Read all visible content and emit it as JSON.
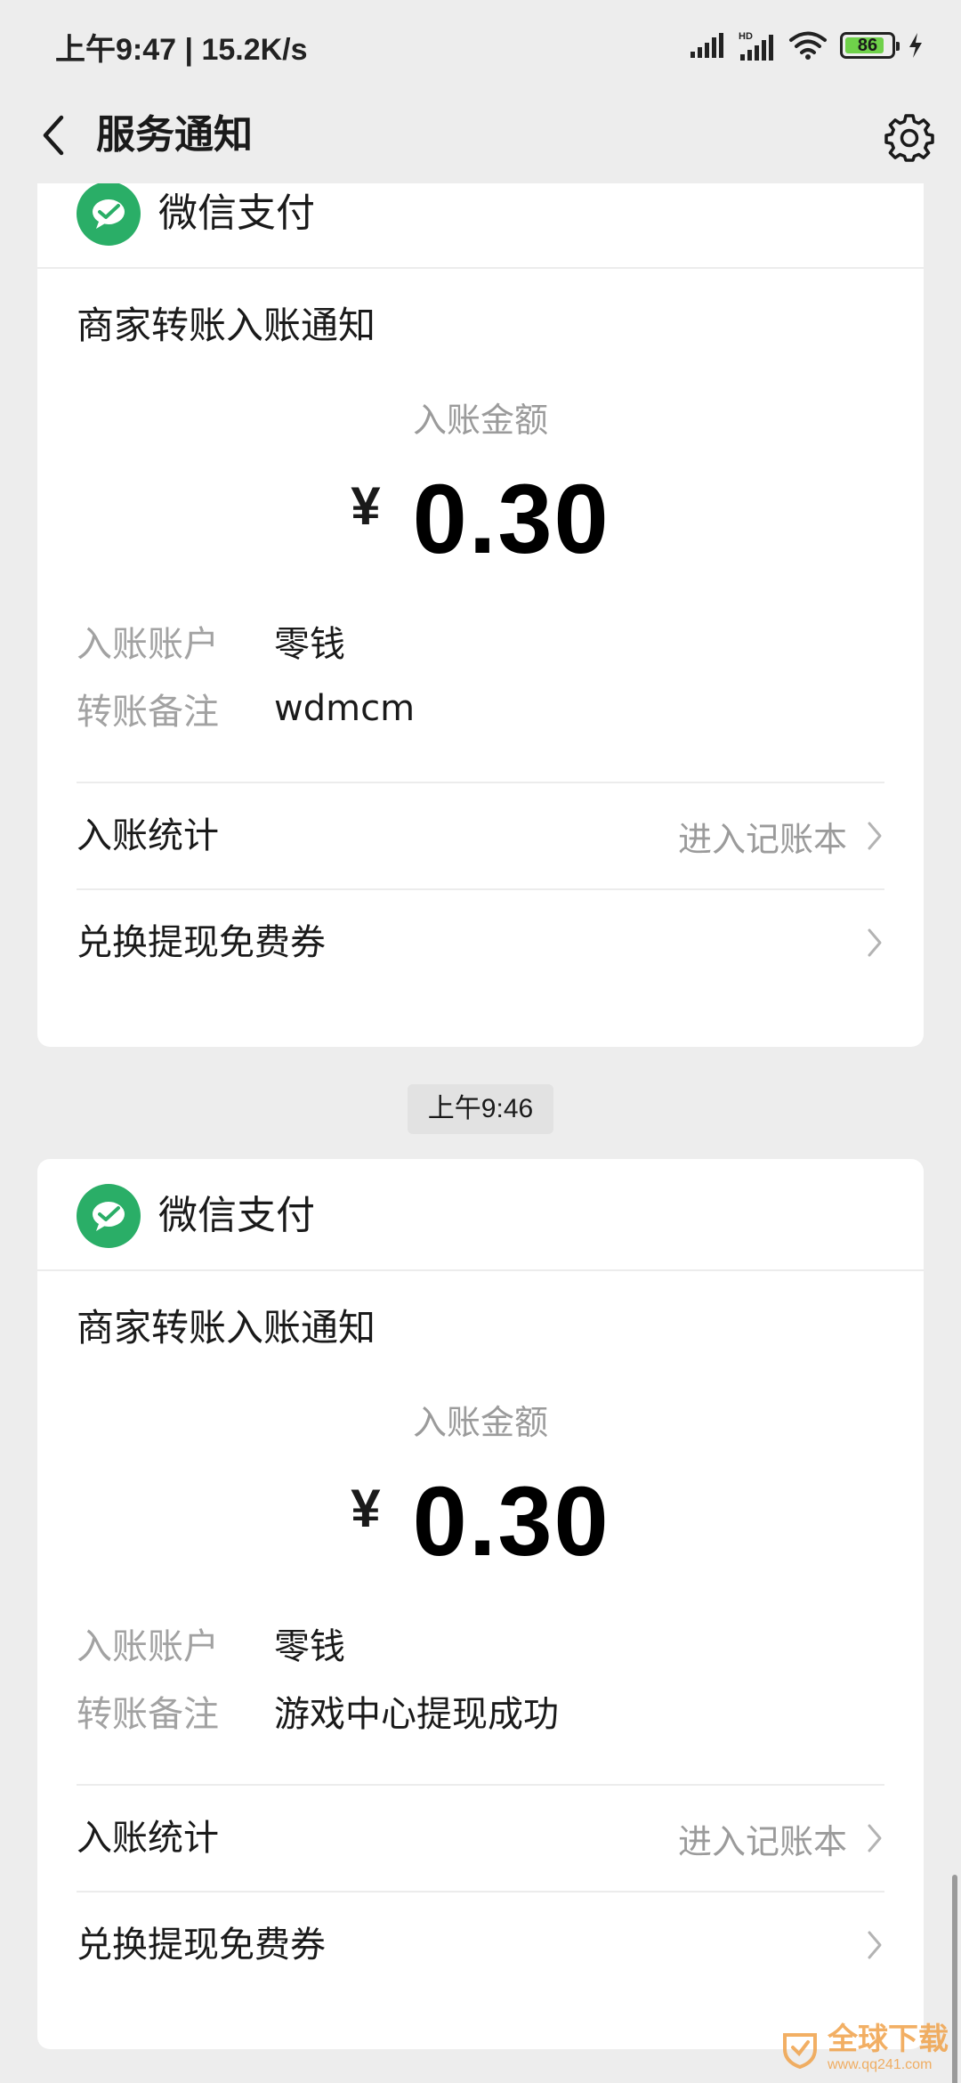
{
  "status_bar": {
    "time_speed": "上午9:47 | 15.2K/s",
    "battery_level": "86",
    "battery_percent": 86,
    "icons": [
      "signal-icon",
      "hd-signal-icon",
      "wifi-icon",
      "battery-icon",
      "charging-icon"
    ]
  },
  "nav": {
    "title": "服务通知",
    "back_icon": "chevron-left-icon",
    "settings_icon": "gear-icon"
  },
  "colors": {
    "wechat_green": "#2aae67",
    "background": "#ededed",
    "card": "#ffffff",
    "muted_text": "#9b9b9b"
  },
  "timestamp_between": "上午9:46",
  "cards": [
    {
      "pay_name": "微信支付",
      "title": "商家转账入账通知",
      "amount_label": "入账金额",
      "currency": "¥",
      "amount": "0.30",
      "details": [
        {
          "label": "入账账户",
          "value": "零钱"
        },
        {
          "label": "转账备注",
          "value": "wdmcm"
        }
      ],
      "links": [
        {
          "label": "入账统计",
          "hint": "进入记账本"
        },
        {
          "label": "兑换提现免费券",
          "hint": ""
        }
      ]
    },
    {
      "pay_name": "微信支付",
      "title": "商家转账入账通知",
      "amount_label": "入账金额",
      "currency": "¥",
      "amount": "0.30",
      "details": [
        {
          "label": "入账账户",
          "value": "零钱"
        },
        {
          "label": "转账备注",
          "value": "游戏中心提现成功"
        }
      ],
      "links": [
        {
          "label": "入账统计",
          "hint": "进入记账本"
        },
        {
          "label": "兑换提现免费券",
          "hint": ""
        }
      ]
    }
  ],
  "watermark": {
    "title": "全球下载",
    "subtitle": "www.qq241.com"
  }
}
